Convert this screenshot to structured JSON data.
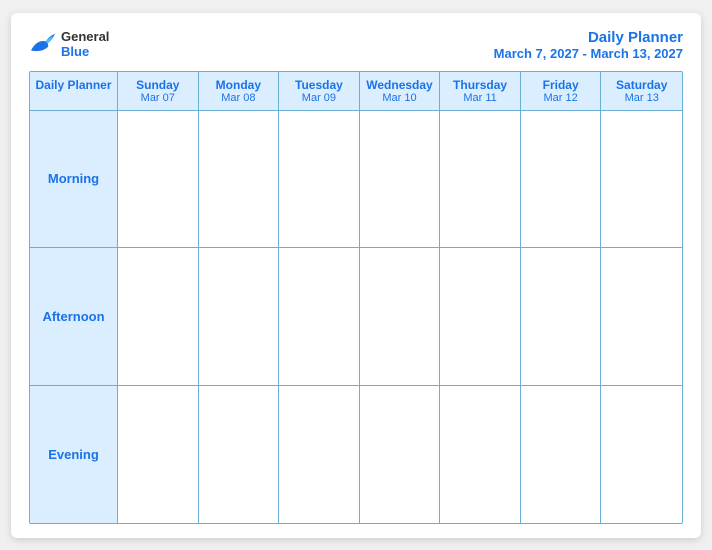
{
  "header": {
    "logo": {
      "text_general": "General",
      "text_blue": "Blue"
    },
    "title": {
      "main": "Daily Planner",
      "sub": "March 7, 2027 - March 13, 2027"
    }
  },
  "calendar": {
    "columns": [
      {
        "name": "Daily\nPlanner",
        "date": ""
      },
      {
        "name": "Sunday",
        "date": "Mar 07"
      },
      {
        "name": "Monday",
        "date": "Mar 08"
      },
      {
        "name": "Tuesday",
        "date": "Mar 09"
      },
      {
        "name": "Wednesday",
        "date": "Mar 10"
      },
      {
        "name": "Thursday",
        "date": "Mar 11"
      },
      {
        "name": "Friday",
        "date": "Mar 12"
      },
      {
        "name": "Saturday",
        "date": "Mar 13"
      }
    ],
    "rows": [
      {
        "label": "Morning"
      },
      {
        "label": "Afternoon"
      },
      {
        "label": "Evening"
      }
    ]
  }
}
